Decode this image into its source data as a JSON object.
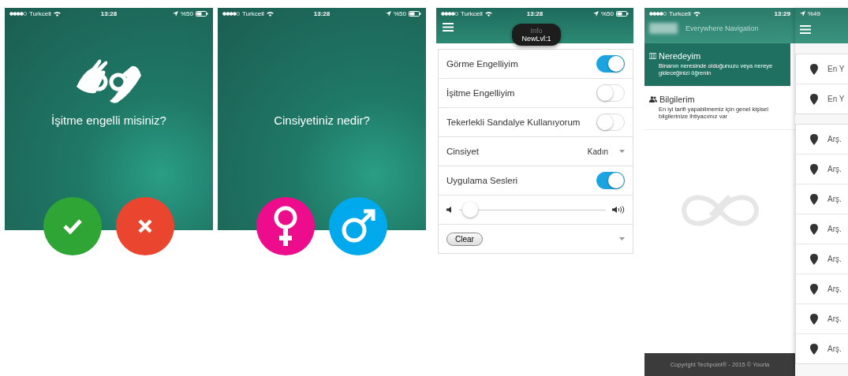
{
  "question_screens": [
    {
      "status": {
        "carrier": "Turkcell",
        "time": "13:28",
        "battery": "%50"
      },
      "question": "İşitme engelli misiniz?",
      "answers": [
        {
          "kind": "check"
        },
        {
          "kind": "cross"
        }
      ]
    },
    {
      "status": {
        "carrier": "Turkcell",
        "time": "13:28",
        "battery": "%50"
      },
      "question": "Cinsiyetiniz nedir?",
      "answers": [
        {
          "kind": "female"
        },
        {
          "kind": "male"
        }
      ]
    }
  ],
  "settings_screen": {
    "status": {
      "carrier": "Turkcell",
      "time": "13:28",
      "battery": "%50"
    },
    "toast": {
      "title": "Info",
      "text": "NewLvl:1"
    },
    "rows": [
      {
        "kind": "toggle",
        "label": "Görme Engelliyim",
        "on": true
      },
      {
        "kind": "toggle",
        "label": "İşitme Engelliyim",
        "on": false
      },
      {
        "kind": "toggle",
        "label": "Tekerlekli Sandalye Kullanıyorum",
        "on": false
      },
      {
        "kind": "select",
        "label": "Cinsiyet",
        "value": "Kadın"
      },
      {
        "kind": "toggle",
        "label": "Uygulama Sesleri",
        "on": true
      },
      {
        "kind": "slider",
        "level": 0.02
      },
      {
        "kind": "clear",
        "label": "Clear"
      }
    ]
  },
  "navigation_screen": {
    "status": {
      "carrier": "Turkcell",
      "time": "13:29",
      "battery": "%49"
    },
    "app_title": "Everywhere Navigation",
    "menu_items": [
      {
        "title": "Neredeyim",
        "description": "Binanın neresinde olduğunuzu veya nereye gideceğinizi öğrenin",
        "selected": true
      },
      {
        "title": "Bilgilerim",
        "description": "En iyi tarifi yapabilmemiz için genel kişisel bilgilerinize ihtiyacımız var",
        "selected": false
      }
    ],
    "footer": "Copyright Techpoint® - 2015 © Yourla",
    "location_groups": [
      [
        "En Y",
        "En Y"
      ],
      [
        "Arş.",
        "Arş.",
        "Arş.",
        "Arş.",
        "Arş.",
        "Arş.",
        "Arş.",
        "Arş."
      ]
    ]
  }
}
